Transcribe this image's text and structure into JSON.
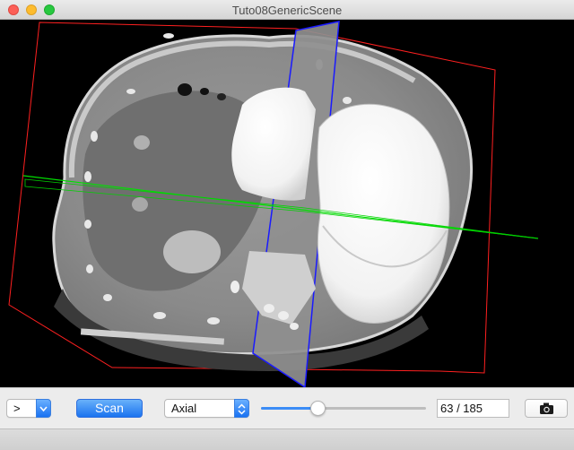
{
  "window": {
    "title": "Tuto08GenericScene"
  },
  "toolbar": {
    "action_combo_value": ">",
    "scan_label": "Scan",
    "orientation_value": "Axial",
    "slice_index": 63,
    "slice_count": 185,
    "slice_text": "63 / 185",
    "snapshot_icon": "camera-icon"
  },
  "colors": {
    "accent": "#1b73ef",
    "axial_plane": "#00e000",
    "sagittal_plane": "#1a1aff",
    "frontal_plane": "#ff2020"
  }
}
